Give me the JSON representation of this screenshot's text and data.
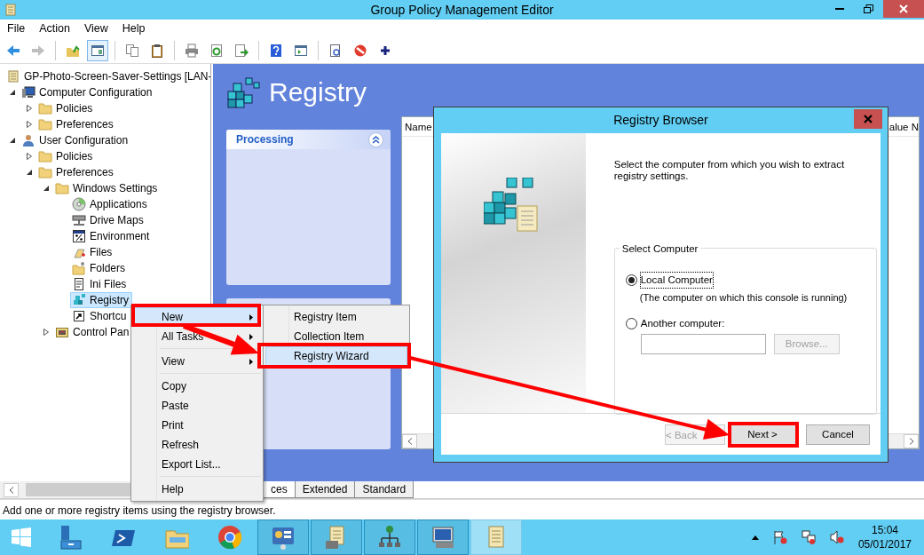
{
  "window": {
    "title": "Group Policy Management Editor"
  },
  "menu_bar": [
    "File",
    "Action",
    "View",
    "Help"
  ],
  "toolbar": {
    "groups": [
      [
        {
          "kind": "back",
          "disabled": false,
          "pressed": false
        },
        {
          "kind": "forward",
          "disabled": true,
          "pressed": false
        }
      ],
      [
        {
          "kind": "up",
          "disabled": false,
          "pressed": false
        },
        {
          "kind": "tree",
          "disabled": false,
          "pressed": true
        }
      ],
      [
        {
          "kind": "copy",
          "disabled": false,
          "pressed": false
        },
        {
          "kind": "paste",
          "disabled": false,
          "pressed": false
        }
      ],
      [
        {
          "kind": "print",
          "disabled": false,
          "pressed": false
        },
        {
          "kind": "refresh",
          "disabled": false,
          "pressed": false
        },
        {
          "kind": "export",
          "disabled": false,
          "pressed": false
        }
      ],
      [
        {
          "kind": "help",
          "disabled": false,
          "pressed": false
        },
        {
          "kind": "pane",
          "disabled": false,
          "pressed": false
        }
      ],
      [
        {
          "kind": "properties",
          "disabled": false,
          "pressed": false
        },
        {
          "kind": "stop",
          "disabled": false,
          "pressed": false
        },
        {
          "kind": "add",
          "disabled": false,
          "pressed": false
        }
      ]
    ]
  },
  "tree": {
    "nodes": [
      {
        "label": "GP-Photo-Screen-Saver-Settings [LAN-",
        "kind": "gpo",
        "selected": false,
        "children": [
          {
            "label": "Computer Configuration",
            "kind": "computer",
            "expanded": true,
            "selected": false,
            "children": [
              {
                "label": "Policies",
                "kind": "folder",
                "expanded": false,
                "selected": false
              },
              {
                "label": "Preferences",
                "kind": "folder",
                "expanded": false,
                "selected": false
              }
            ]
          },
          {
            "label": "User Configuration",
            "kind": "user",
            "expanded": true,
            "selected": false,
            "children": [
              {
                "label": "Policies",
                "kind": "folder",
                "expanded": false,
                "selected": false
              },
              {
                "label": "Preferences",
                "kind": "folder",
                "expanded": true,
                "selected": false,
                "children": [
                  {
                    "label": "Windows Settings",
                    "kind": "folder",
                    "expanded": true,
                    "selected": false,
                    "children": [
                      {
                        "label": "Applications",
                        "kind": "disc",
                        "selected": false
                      },
                      {
                        "label": "Drive Maps",
                        "kind": "drive",
                        "selected": false
                      },
                      {
                        "label": "Environment",
                        "kind": "percent",
                        "selected": false
                      },
                      {
                        "label": "Files",
                        "kind": "files",
                        "selected": false
                      },
                      {
                        "label": "Folders",
                        "kind": "folders",
                        "selected": false
                      },
                      {
                        "label": "Ini Files",
                        "kind": "ini",
                        "selected": false
                      },
                      {
                        "label": "Registry",
                        "kind": "registry",
                        "selected": true
                      },
                      {
                        "label": "Shortcu",
                        "kind": "shortcut",
                        "selected": false
                      }
                    ]
                  },
                  {
                    "label": "Control Pan",
                    "kind": "control",
                    "expanded": false,
                    "selected": false
                  }
                ]
              }
            ]
          }
        ]
      }
    ]
  },
  "content": {
    "title": "Registry",
    "panel": {
      "title": "Processing",
      "collapsed": false
    },
    "list": {
      "columns": [
        "Name",
        "alue N"
      ]
    }
  },
  "bottom_tabs": [
    {
      "label": "ces",
      "selected": true
    },
    {
      "label": "Extended",
      "selected": false
    },
    {
      "label": "Standard",
      "selected": false
    }
  ],
  "status_bar": "Add one or more registry items using the registry browser.",
  "context_menu": {
    "items": [
      {
        "kind": "item",
        "label": "New",
        "submenu": true,
        "highlighted": true
      },
      {
        "kind": "item",
        "label": "All Tasks",
        "submenu": true,
        "highlighted": false
      },
      {
        "kind": "separator"
      },
      {
        "kind": "item",
        "label": "View",
        "submenu": true,
        "highlighted": false
      },
      {
        "kind": "separator"
      },
      {
        "kind": "item",
        "label": "Copy",
        "submenu": false,
        "highlighted": false
      },
      {
        "kind": "item",
        "label": "Paste",
        "submenu": false,
        "highlighted": false
      },
      {
        "kind": "item",
        "label": "Print",
        "submenu": false,
        "highlighted": false
      },
      {
        "kind": "item",
        "label": "Refresh",
        "submenu": false,
        "highlighted": false
      },
      {
        "kind": "item",
        "label": "Export List...",
        "submenu": false,
        "highlighted": false
      },
      {
        "kind": "separator"
      },
      {
        "kind": "item",
        "label": "Help",
        "submenu": false,
        "highlighted": false
      }
    ]
  },
  "submenu": {
    "items": [
      {
        "label": "Registry Item",
        "highlighted": false
      },
      {
        "label": "Collection Item",
        "highlighted": false
      },
      {
        "label": "Registry Wizard",
        "highlighted": true
      }
    ]
  },
  "dialog": {
    "title": "Registry Browser",
    "instruction": "Select the computer from which you wish to extract registry settings.",
    "group_title": "Select Computer",
    "options": [
      {
        "label": "Local Computer",
        "selected": true,
        "note": "(The computer on which this console is running)"
      },
      {
        "label": "Another computer:",
        "selected": false
      }
    ],
    "browse_button": {
      "label": "Browse...",
      "disabled": true
    },
    "buttons": [
      {
        "label": "< Back",
        "disabled": true
      },
      {
        "label": "Next >",
        "disabled": false
      },
      {
        "label": "Cancel",
        "disabled": false
      }
    ]
  },
  "taskbar": {
    "apps": [
      {
        "kind": "server",
        "running": false,
        "active": false
      },
      {
        "kind": "shell",
        "running": false,
        "active": false
      },
      {
        "kind": "explorer",
        "running": false,
        "active": false
      },
      {
        "kind": "browser",
        "running": false,
        "active": false
      },
      {
        "kind": "panel",
        "running": true,
        "active": false
      },
      {
        "kind": "gpm",
        "running": true,
        "active": false
      },
      {
        "kind": "network",
        "running": true,
        "active": false
      },
      {
        "kind": "remote",
        "running": true,
        "active": false
      },
      {
        "kind": "scroll",
        "running": true,
        "active": true
      }
    ],
    "clock": {
      "time": "15:04",
      "date": "05/01/2017"
    }
  }
}
